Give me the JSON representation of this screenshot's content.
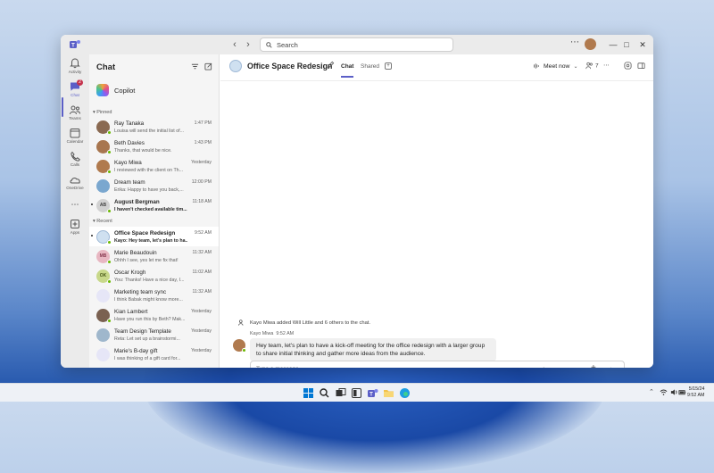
{
  "search": {
    "placeholder": "Search"
  },
  "rail": {
    "items": [
      {
        "label": "Activity",
        "icon": "bell-icon"
      },
      {
        "label": "Chat",
        "icon": "chat-icon",
        "badge": "2"
      },
      {
        "label": "Teams",
        "icon": "teams-icon"
      },
      {
        "label": "Calendar",
        "icon": "calendar-icon"
      },
      {
        "label": "Calls",
        "icon": "phone-icon"
      },
      {
        "label": "OneDrive",
        "icon": "cloud-icon"
      },
      {
        "label": "Apps",
        "icon": "apps-icon"
      }
    ]
  },
  "chatlist": {
    "title": "Chat",
    "copilot": "Copilot",
    "pinned_label": "Pinned",
    "recent_label": "Recent",
    "pinned": [
      {
        "name": "Ray Tanaka",
        "preview": "Louisa will send the initial list of...",
        "time": "1:47 PM",
        "initials": "",
        "color": "#8a6a52",
        "status": "available"
      },
      {
        "name": "Beth Davies",
        "preview": "Thanks, that would be nice.",
        "time": "1:43 PM",
        "initials": "",
        "color": "#a8764f",
        "status": "available"
      },
      {
        "name": "Kayo Miwa",
        "preview": "I reviewed with the client on Th...",
        "time": "Yesterday",
        "initials": "",
        "color": "#b07a4e",
        "status": "available"
      },
      {
        "name": "Dream team",
        "preview": "Erika: Happy to have you back,...",
        "time": "12:00 PM",
        "initials": "",
        "color": "#7aa7cf",
        "status": ""
      },
      {
        "name": "August Bergman",
        "preview": "I haven't checked available tim...",
        "time": "11:18 AM",
        "initials": "AB",
        "color": "#d1d1d1",
        "status": "available",
        "unread": true
      }
    ],
    "recent": [
      {
        "name": "Office Space Redesign",
        "preview": "Kayo: Hey team, let's plan to ha...",
        "time": "9:52 AM",
        "initials": "",
        "color": "#cfe0f0",
        "status": "",
        "unread": true,
        "selected": true
      },
      {
        "name": "Marie Beaudouin",
        "preview": "Ohhh I see, yes let me fix that!",
        "time": "11:32 AM",
        "initials": "MB",
        "color": "#e8b7c2",
        "status": "available"
      },
      {
        "name": "Oscar Krogh",
        "preview": "You: Thanks! Have a nice day, I...",
        "time": "11:02 AM",
        "initials": "OK",
        "color": "#c8d88a",
        "status": "available"
      },
      {
        "name": "Marketing team sync",
        "preview": "I think Babak might know more...",
        "time": "11:32 AM",
        "initials": "",
        "color": "#e6e6f7",
        "status": ""
      },
      {
        "name": "Kian Lambert",
        "preview": "Have you run this by Beth? Mak...",
        "time": "Yesterday",
        "initials": "",
        "color": "#7a6151",
        "status": "available"
      },
      {
        "name": "Team Design Template",
        "preview": "Reta: Let set up a brainstormi...",
        "time": "Yesterday",
        "initials": "",
        "color": "#9fb7cc",
        "status": ""
      },
      {
        "name": "Marie's B-day gift",
        "preview": "I was thinking of a gift card for...",
        "time": "Yesterday",
        "initials": "",
        "color": "#e6e6f7",
        "status": ""
      }
    ]
  },
  "conversation": {
    "title": "Office Space Redesign",
    "tabs": [
      "Chat",
      "Shared"
    ],
    "meet_now": "Meet now",
    "participants": "7",
    "system_message": "Kayo Miwa added Will Little and 6 others to the chat.",
    "message": {
      "author": "Kayo Miwa",
      "time": "9:52 AM",
      "text": "Hey team, let's plan to have a kick-off meeting for the office redesign with a larger group to share initial thinking and gather more ideas from the audience."
    },
    "composer_placeholder": "Type a message"
  },
  "taskbar": {
    "date": "5/15/24",
    "time": "9:52 AM"
  },
  "colors": {
    "accent": "#5b5fc7",
    "presence_available": "#6bb700"
  }
}
